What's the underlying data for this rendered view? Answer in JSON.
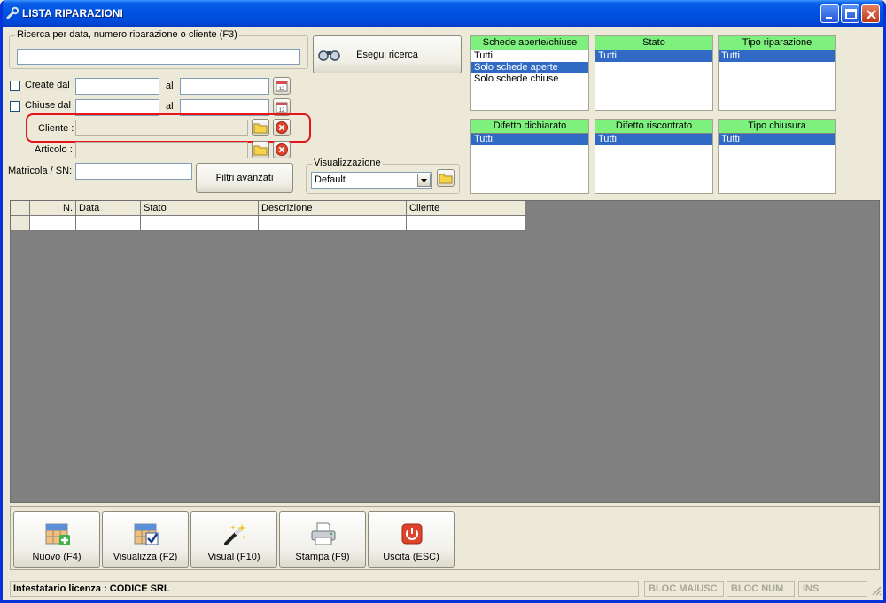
{
  "window": {
    "title": "LISTA RIPARAZIONI"
  },
  "search": {
    "group_label": "Ricerca per data, numero riparazione o cliente (F3)",
    "value": "",
    "run_button": "Esegui ricerca"
  },
  "dates": {
    "created_label": "Create dal",
    "closed_label": "Chiuse dal",
    "al_label": "al",
    "created_from": "",
    "created_to": "",
    "closed_from": "",
    "closed_to": ""
  },
  "filters": {
    "cliente_label": "Cliente :",
    "articolo_label": "Articolo :",
    "matricola_label": "Matricola / SN:",
    "advanced_button": "Filtri avanzati"
  },
  "visualizzazione": {
    "label": "Visualizzazione",
    "selected": "Default"
  },
  "lists": [
    {
      "header": "Schede aperte/chiuse",
      "items": [
        "Tutti",
        "Solo schede aperte",
        "Solo schede chiuse"
      ],
      "selected": 1
    },
    {
      "header": "Stato",
      "items": [
        "Tutti"
      ],
      "selected": 0
    },
    {
      "header": "Tipo riparazione",
      "items": [
        "Tutti"
      ],
      "selected": 0
    },
    {
      "header": "Difetto dichiarato",
      "items": [
        "Tutti"
      ],
      "selected": 0
    },
    {
      "header": "Difetto riscontrato",
      "items": [
        "Tutti"
      ],
      "selected": 0
    },
    {
      "header": "Tipo chiusura",
      "items": [
        "Tutti"
      ],
      "selected": 0
    }
  ],
  "grid": {
    "columns": [
      "N.",
      "Data",
      "Stato",
      "Descrizione",
      "Cliente"
    ]
  },
  "actions": {
    "new": "Nuovo (F4)",
    "view": "Visualizza (F2)",
    "visual": "Visual (F10)",
    "print": "Stampa (F9)",
    "exit": "Uscita (ESC)"
  },
  "status": {
    "license": "Intestatario licenza : CODICE SRL",
    "caps": "BLOC MAIUSC",
    "num": "BLOC NUM",
    "ins": "INS"
  },
  "colors": {
    "list_header": "#7df07d",
    "selection": "#316ac5",
    "highlight": "#e8141c"
  }
}
